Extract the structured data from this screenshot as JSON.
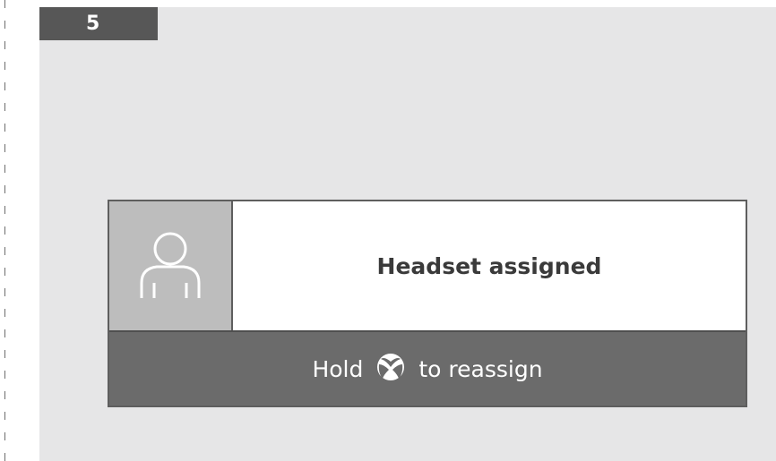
{
  "step": {
    "number": "5"
  },
  "notification": {
    "avatar_icon": "person-icon",
    "message": "Headset assigned",
    "action": {
      "prefix": "Hold",
      "button_icon": "xbox-button-icon",
      "suffix": "to reassign"
    }
  },
  "colors": {
    "panel_background": "#e6e6e7",
    "step_tab": "#575757",
    "avatar_background": "#bdbdbd",
    "action_bar": "#6b6b6b",
    "message_text": "#3a3a3a"
  }
}
